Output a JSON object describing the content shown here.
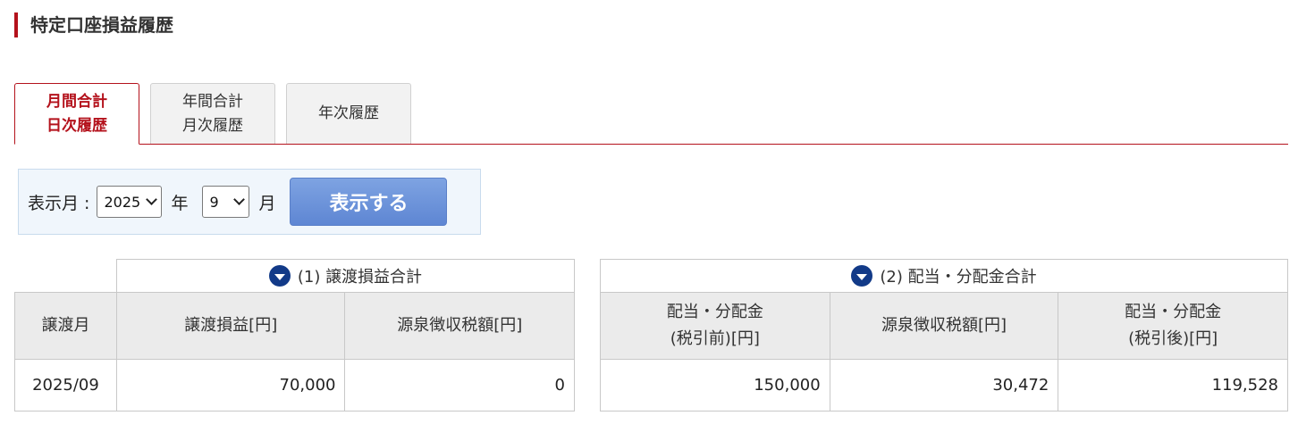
{
  "page": {
    "title": "特定口座損益履歴"
  },
  "tabs": [
    {
      "line1": "月間合計",
      "line2": "日次履歴"
    },
    {
      "line1": "年間合計",
      "line2": "月次履歴"
    },
    {
      "line1": "年次履歴",
      "line2": ""
    }
  ],
  "filter": {
    "label": "表示月 :",
    "year_value": "2025",
    "year_unit": "年",
    "month_value": "9",
    "month_unit": "月",
    "button_label": "表示する"
  },
  "transfer": {
    "group_title": "(1) 譲渡損益合計",
    "headers": [
      "譲渡月",
      "譲渡損益[円]",
      "源泉徴収税額[円]"
    ],
    "row": {
      "month": "2025/09",
      "profit": "70,000",
      "tax": "0"
    }
  },
  "dividend": {
    "group_title": "(2) 配当・分配金合計",
    "headers": [
      {
        "line1": "配当・分配金",
        "line2": "(税引前)[円]"
      },
      {
        "line1": "源泉徴収税額[円]",
        "line2": ""
      },
      {
        "line1": "配当・分配金",
        "line2": "(税引後)[円]"
      }
    ],
    "row": {
      "gross": "150,000",
      "tax": "30,472",
      "net": "119,528"
    }
  },
  "colors": {
    "accent": "#b4121c",
    "button": "#6b93db",
    "icon": "#123a88"
  }
}
